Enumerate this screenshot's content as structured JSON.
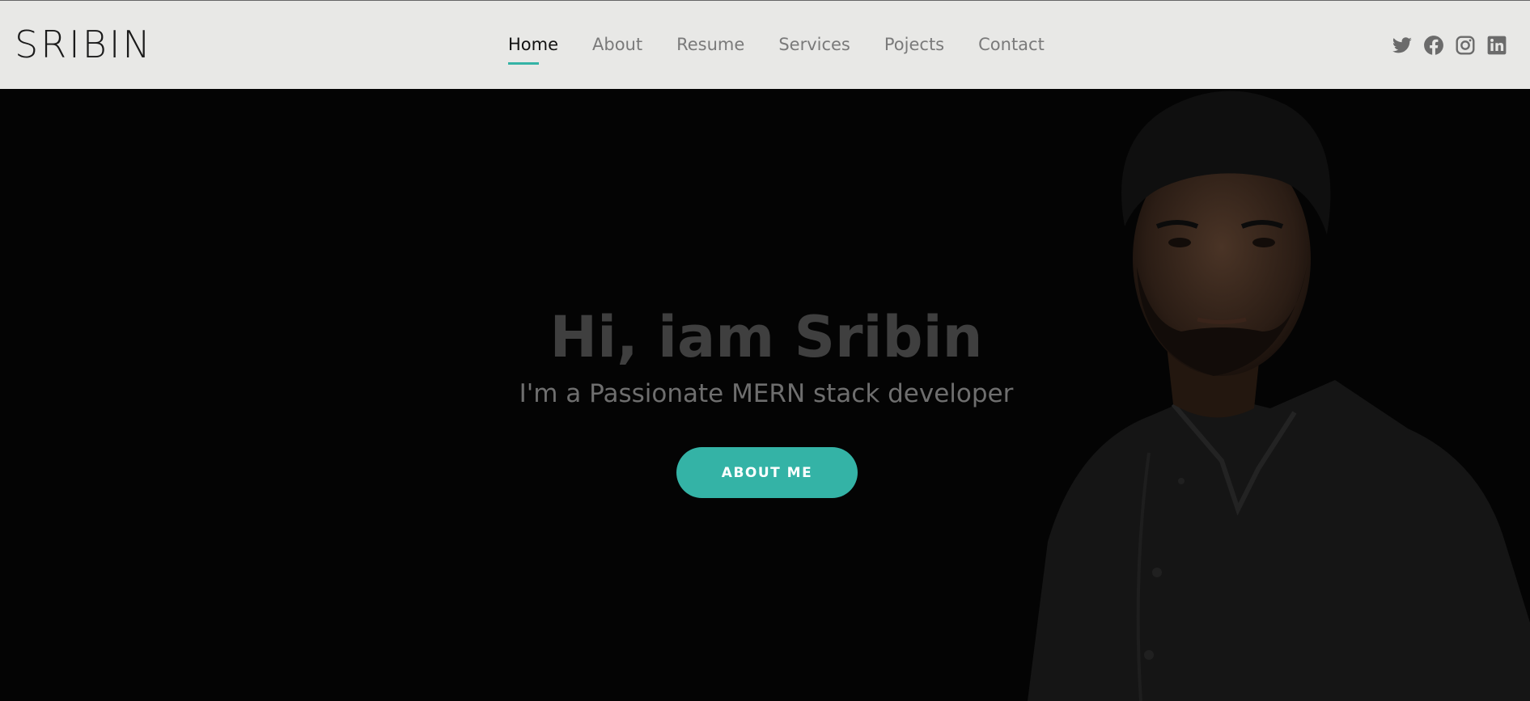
{
  "header": {
    "logo": "SRIBIN",
    "nav": [
      {
        "label": "Home",
        "active": true
      },
      {
        "label": "About",
        "active": false
      },
      {
        "label": "Resume",
        "active": false
      },
      {
        "label": "Services",
        "active": false
      },
      {
        "label": "Pojects",
        "active": false
      },
      {
        "label": "Contact",
        "active": false
      }
    ],
    "social": [
      "twitter-icon",
      "facebook-icon",
      "instagram-icon",
      "linkedin-icon"
    ]
  },
  "hero": {
    "title": "Hi, iam Sribin",
    "subtitle": "I'm a Passionate MERN stack developer",
    "button_label": "ABOUT ME"
  },
  "colors": {
    "accent": "#34b3a6",
    "header_bg": "#e8e8e6",
    "hero_bg": "#040404",
    "nav_text": "#7a7a7a",
    "nav_active": "#111111"
  }
}
